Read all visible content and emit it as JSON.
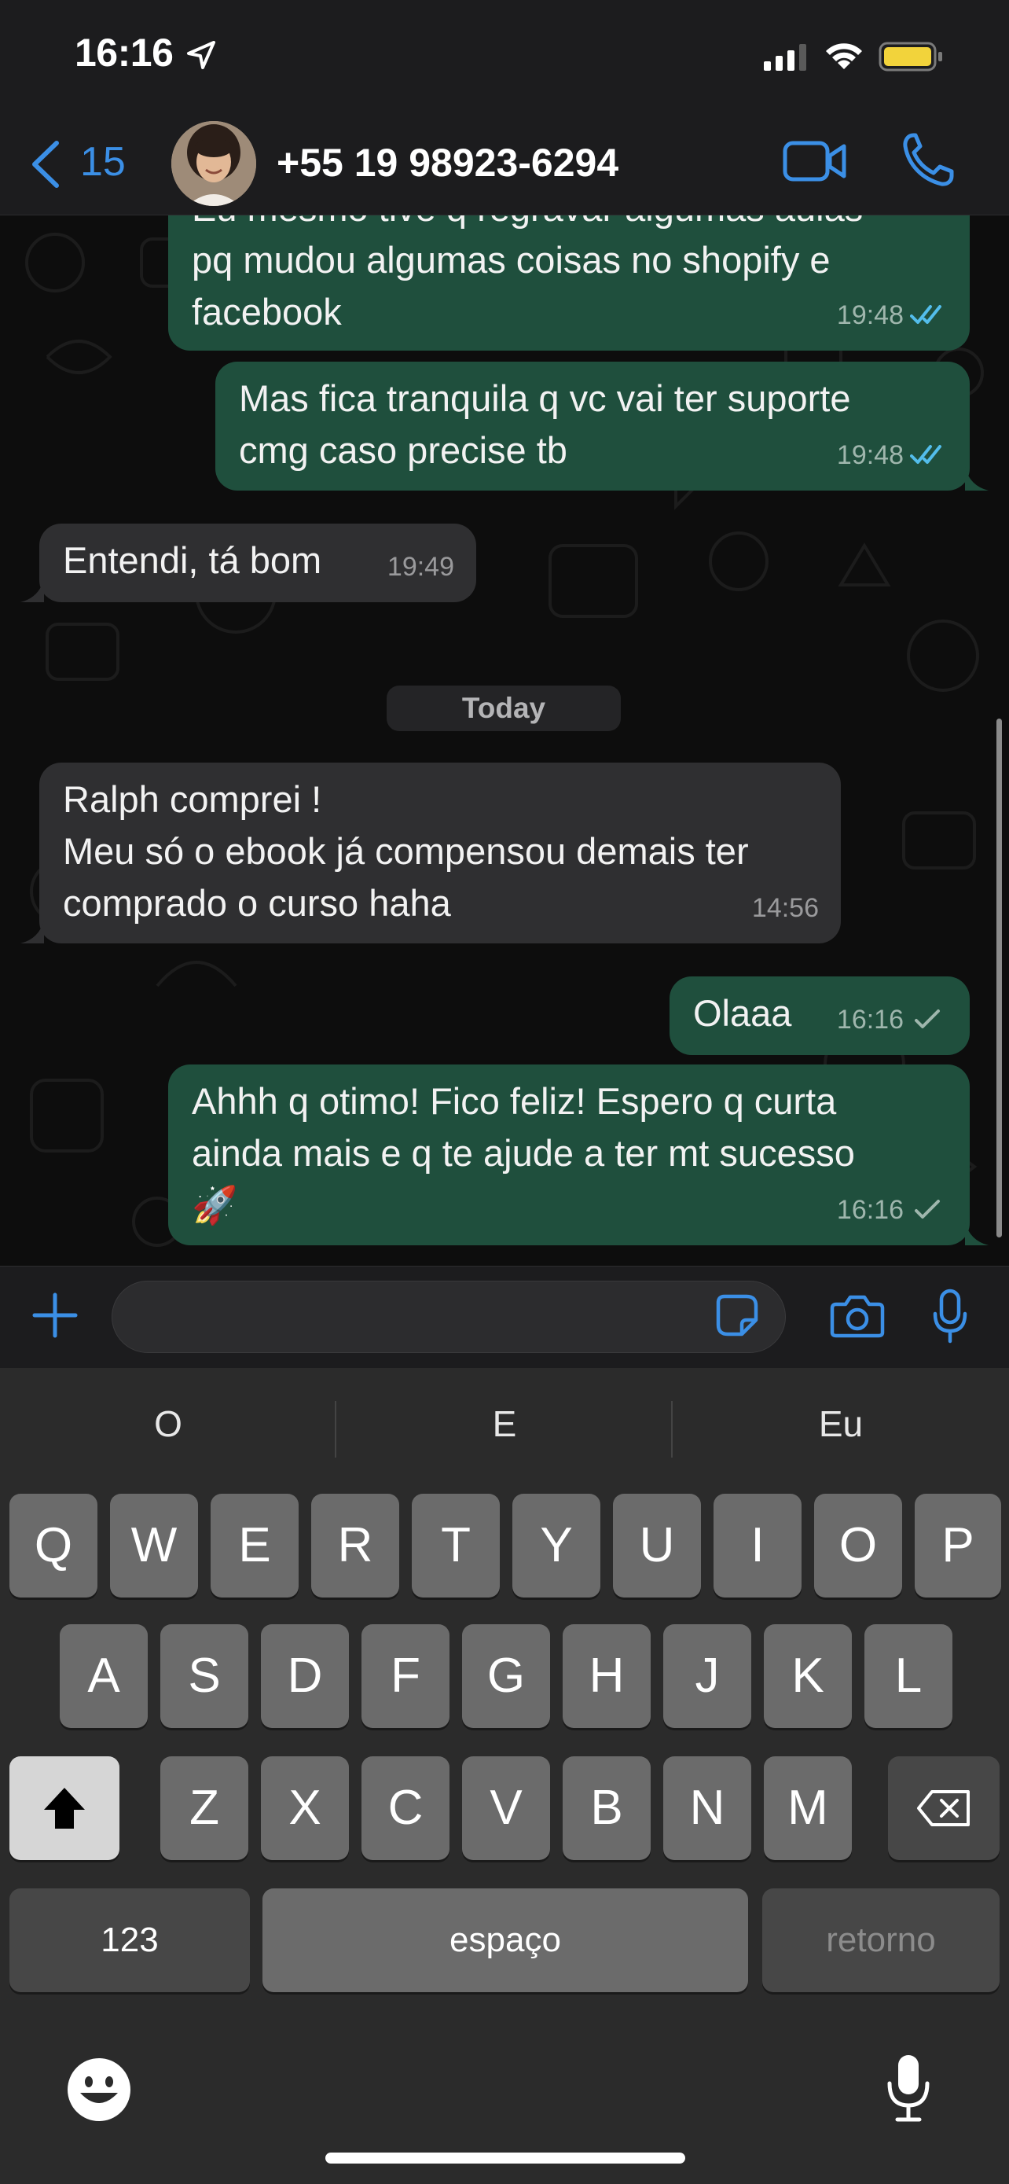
{
  "status_bar": {
    "time": "16:16"
  },
  "header": {
    "back_count": "15",
    "contact_name": "+55 19 98923-6294"
  },
  "messages": [
    {
      "direction": "out",
      "text": "Eu mesmo tive q regravar algumas aulas\npq mudou algumas coisas no shopify e\nfacebook",
      "time": "19:48",
      "status": "read"
    },
    {
      "direction": "out",
      "text": "Mas fica tranquila q vc vai ter suporte\ncmg caso precise tb",
      "time": "19:48",
      "status": "read"
    },
    {
      "direction": "in",
      "text": "Entendi, tá bom",
      "time": "19:49"
    },
    {
      "direction": "in",
      "text": "Ralph comprei !\nMeu só o ebook já compensou demais ter\ncomprado o curso haha",
      "time": "14:56"
    },
    {
      "direction": "out",
      "text": "Olaaa",
      "time": "16:16",
      "status": "sent"
    },
    {
      "direction": "out",
      "text": "Ahhh q otimo! Fico feliz! Espero q curta\nainda mais e q te ajude a ter mt sucesso\n🚀",
      "time": "16:16",
      "status": "sent"
    }
  ],
  "day_separator": "Today",
  "composer": {
    "value": ""
  },
  "keyboard": {
    "suggestions": [
      "O",
      "E",
      "Eu"
    ],
    "row1": [
      "Q",
      "W",
      "E",
      "R",
      "T",
      "Y",
      "U",
      "I",
      "O",
      "P"
    ],
    "row2": [
      "A",
      "S",
      "D",
      "F",
      "G",
      "H",
      "J",
      "K",
      "L"
    ],
    "row3": [
      "Z",
      "X",
      "C",
      "V",
      "B",
      "N",
      "M"
    ],
    "numbers_key": "123",
    "space_key": "espaço",
    "return_key": "retorno"
  },
  "colors": {
    "accent": "#3b8fe6",
    "outgoing_bubble": "#1f4f3d",
    "incoming_bubble": "#2f2f31",
    "read_tick": "#53bdeb"
  }
}
